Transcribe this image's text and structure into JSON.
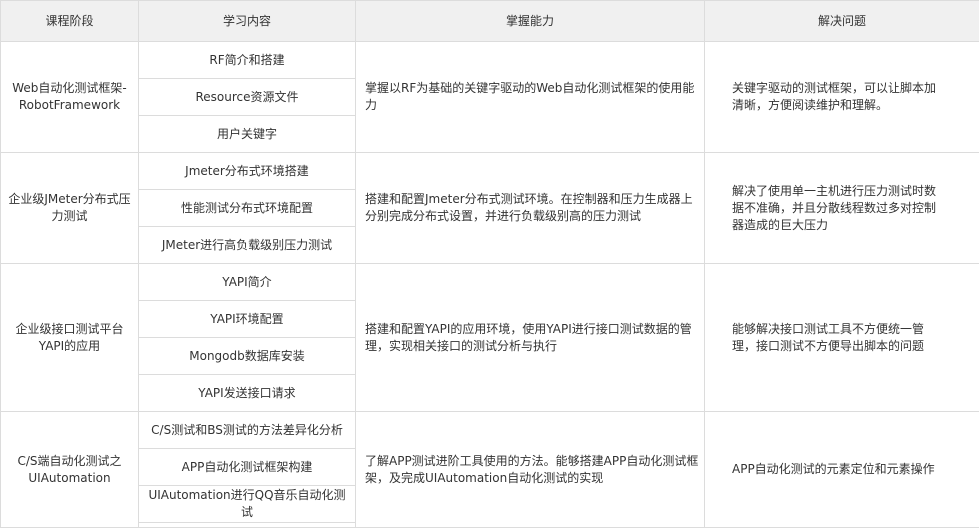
{
  "table": {
    "headers": [
      "课程阶段",
      "学习内容",
      "掌握能力",
      "解决问题"
    ],
    "rows": [
      {
        "stage": "Web自动化测试框架-RobotFramework",
        "contents": [
          "RF简介和搭建",
          "Resource资源文件",
          "用户关键字"
        ],
        "ability": "掌握以RF为基础的关键字驱动的Web自动化测试框架的使用能力",
        "solve": "关键字驱动的测试框架，可以让脚本加清晰，方便阅读维护和理解。"
      },
      {
        "stage": "企业级JMeter分布式压力测试",
        "contents": [
          "Jmeter分布式环境搭建",
          "性能测试分布式环境配置",
          "JMeter进行高负载级别压力测试"
        ],
        "ability": "搭建和配置Jmeter分布式测试环境。在控制器和压力生成器上分别完成分布式设置，并进行负载级别高的压力测试",
        "solve": "解决了使用单一主机进行压力测试时数据不准确，并且分散线程数过多对控制器造成的巨大压力"
      },
      {
        "stage": "企业级接口测试平台YAPI的应用",
        "contents": [
          "YAPI简介",
          "YAPI环境配置",
          "Mongodb数据库安装",
          "YAPI发送接口请求"
        ],
        "ability": "搭建和配置YAPI的应用环境，使用YAPI进行接口测试数据的管理，实现相关接口的测试分析与执行",
        "solve": "能够解决接口测试工具不方便统一管理，接口测试不方便导出脚本的问题"
      },
      {
        "stage": "C/S端自动化测试之UIAutomation",
        "contents": [
          "C/S测试和BS测试的方法差异化分析",
          "APP自动化测试框架构建",
          "UIAutomation进行QQ音乐自动化测试"
        ],
        "ability": "了解APP测试进阶工具使用的方法。能够搭建APP自动化测试框架，及完成UIAutomation自动化测试的实现",
        "solve": "APP自动化测试的元素定位和元素操作"
      }
    ]
  }
}
